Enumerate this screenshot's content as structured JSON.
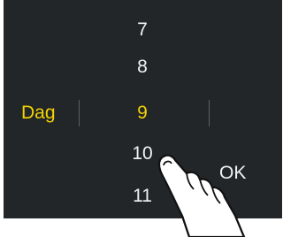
{
  "picker": {
    "field_label": "Dag",
    "values": [
      "7",
      "8",
      "9",
      "10",
      "11"
    ],
    "selected_value": "9"
  },
  "actions": {
    "ok_label": "OK"
  },
  "colors": {
    "background": "#222629",
    "accent": "#f3d300",
    "text": "#f2f2f2"
  },
  "icons": {
    "gesture": "tap-hand-icon"
  }
}
